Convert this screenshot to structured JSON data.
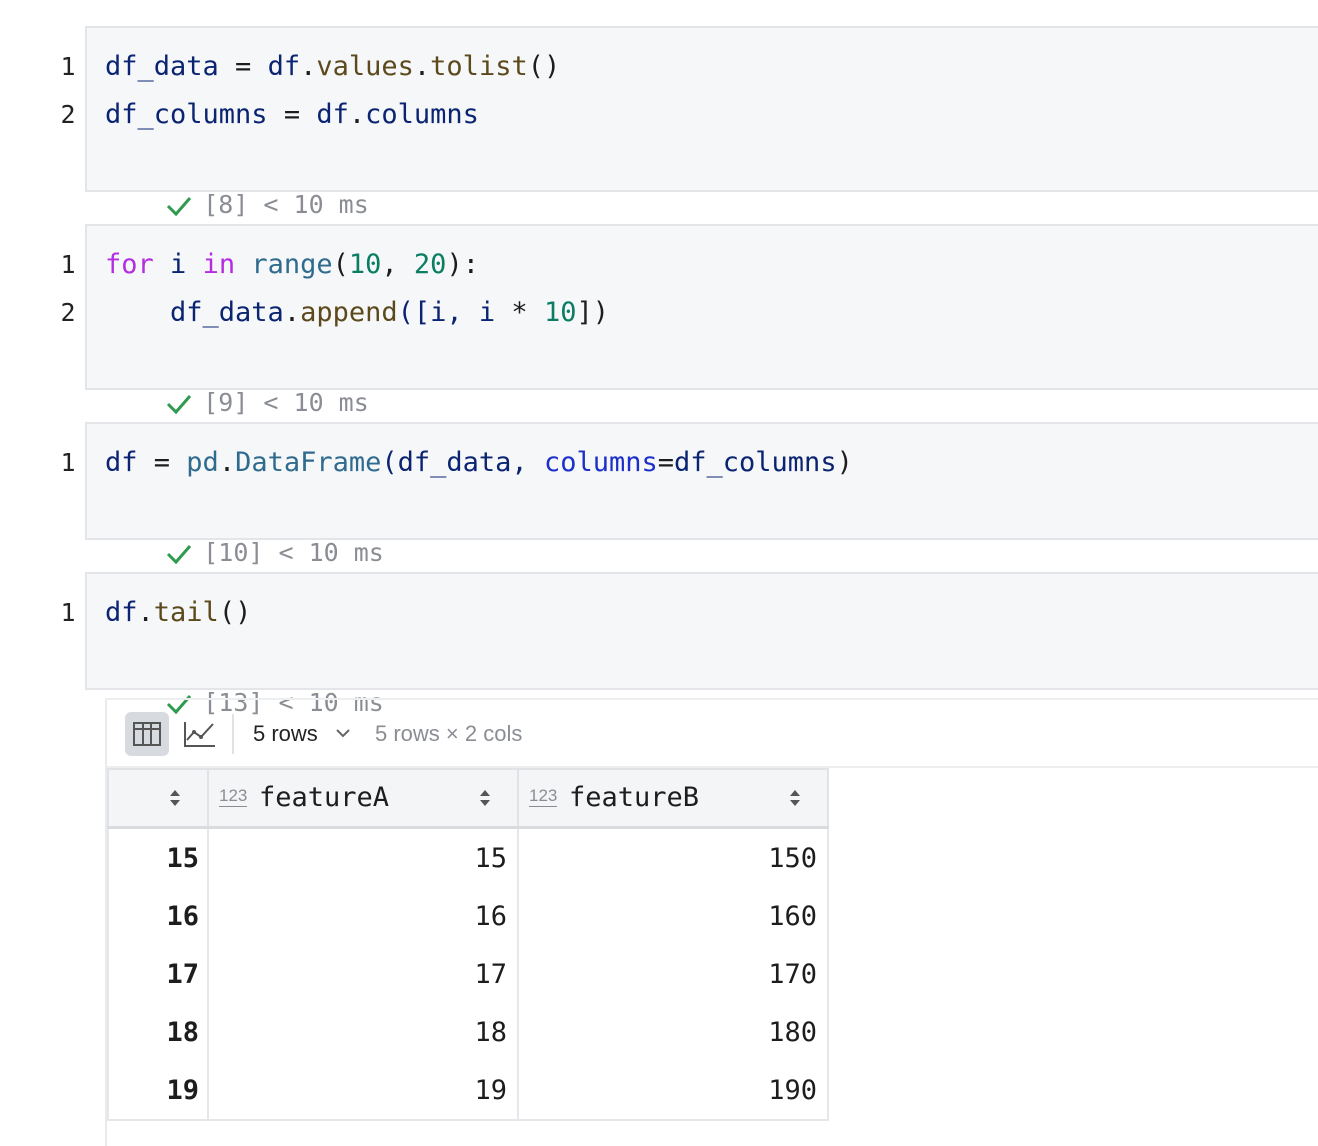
{
  "cells": [
    {
      "line_numbers": [
        "1",
        "2"
      ],
      "lines": [
        [
          "df_data",
          " = ",
          "df",
          ".",
          "values",
          ".",
          "tolist",
          "()"
        ],
        [
          "df_columns",
          " = ",
          "df",
          ".",
          "columns"
        ]
      ],
      "status": "[8] < 10 ms"
    },
    {
      "line_numbers": [
        "1",
        "2"
      ],
      "lines": [
        [
          "for",
          " i ",
          "in",
          " ",
          "range",
          "(",
          "10",
          ", ",
          "20",
          "):"
        ],
        [
          "    df_data",
          ".",
          "append",
          "([i, i ",
          "*",
          " ",
          "10",
          "])"
        ]
      ],
      "status": "[9] < 10 ms"
    },
    {
      "line_numbers": [
        "1"
      ],
      "lines": [
        [
          "df",
          " = ",
          "pd",
          ".",
          "DataFrame",
          "(df_data, ",
          "columns",
          "=",
          "df_columns",
          ")"
        ]
      ],
      "status": "[10] < 10 ms"
    },
    {
      "line_numbers": [
        "1"
      ],
      "lines": [
        [
          "df",
          ".",
          "tail",
          "()"
        ]
      ],
      "status": "[13] < 10 ms"
    }
  ],
  "output": {
    "toolbar": {
      "table_icon": "table-icon",
      "chart_icon": "line-chart-icon",
      "rows_select": "5 rows",
      "shape": "5 rows × 2 cols"
    },
    "table": {
      "type_badge": "123",
      "columns": [
        "featureA",
        "featureB"
      ],
      "rows": [
        {
          "index": "15",
          "featureA": "15",
          "featureB": "150"
        },
        {
          "index": "16",
          "featureA": "16",
          "featureB": "160"
        },
        {
          "index": "17",
          "featureA": "17",
          "featureB": "170"
        },
        {
          "index": "18",
          "featureA": "18",
          "featureB": "180"
        },
        {
          "index": "19",
          "featureA": "19",
          "featureB": "190"
        }
      ]
    }
  },
  "colors": {
    "check": "#2e9b4e",
    "keyword": "#b52de0",
    "number": "#0b7d63",
    "function": "#5c4a1c"
  }
}
